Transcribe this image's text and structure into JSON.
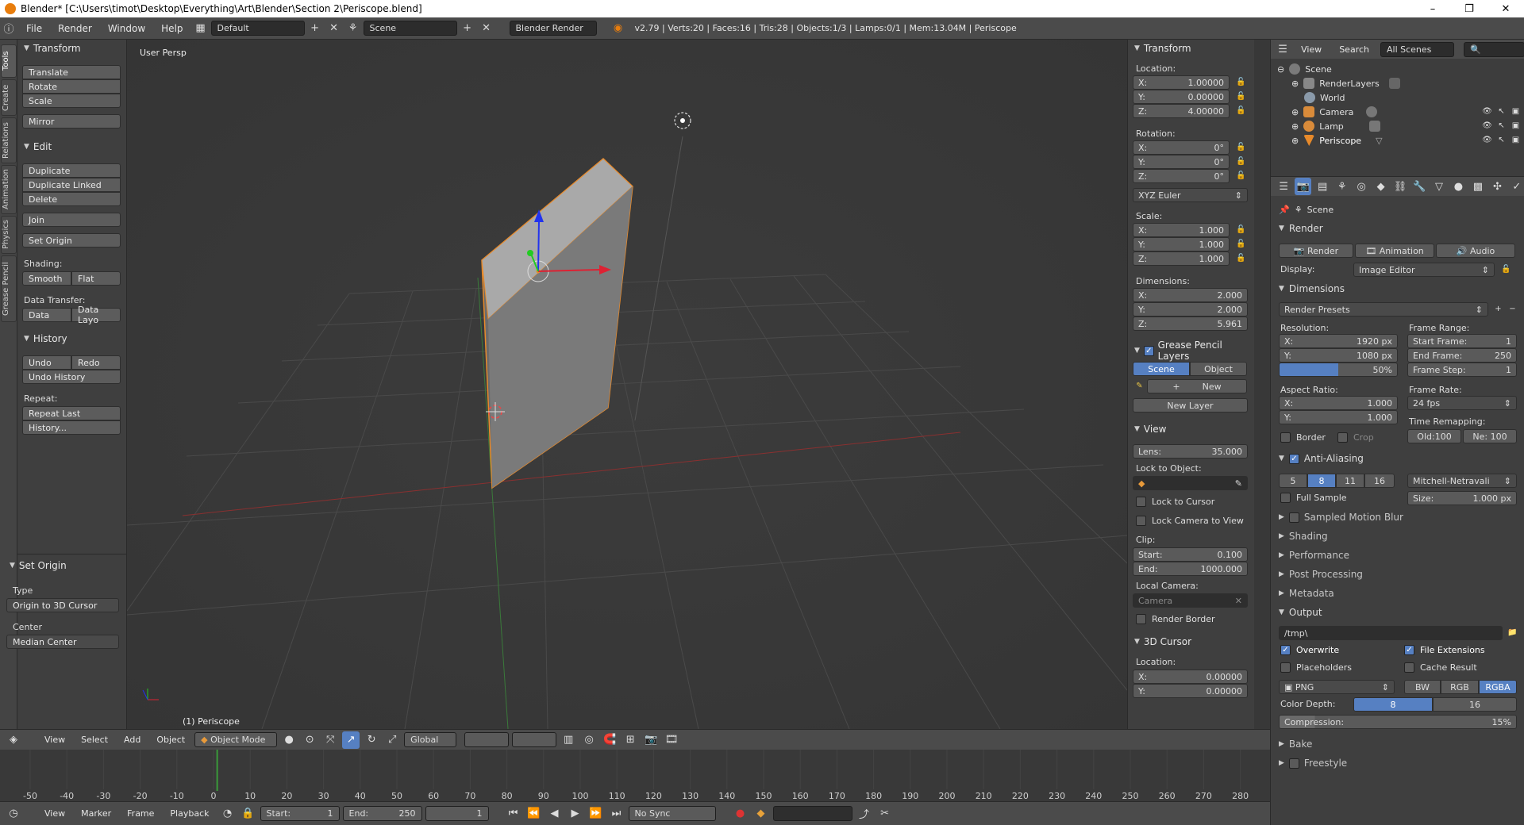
{
  "titlebar": {
    "title": "Blender* [C:\\Users\\timot\\Desktop\\Everything\\Art\\Blender\\Section 2\\Periscope.blend]",
    "minimize": "–",
    "maximize": "❐",
    "close": "✕"
  },
  "infobar": {
    "menus": [
      "File",
      "Render",
      "Window",
      "Help"
    ],
    "layout": "Default",
    "scene": "Scene",
    "engine": "Blender Render",
    "stats": "v2.79 | Verts:20 | Faces:16 | Tris:28 | Objects:1/3 | Lamps:0/1 | Mem:13.04M | Periscope"
  },
  "left_tabs": [
    "Tools",
    "Create",
    "Relations",
    "Animation",
    "Physics",
    "Grease Pencil"
  ],
  "toolshelf": {
    "transform_header": "Transform",
    "transform_buttons": [
      "Translate",
      "Rotate",
      "Scale",
      "Mirror"
    ],
    "edit_header": "Edit",
    "edit_buttons": [
      "Duplicate",
      "Duplicate Linked",
      "Delete",
      "Join",
      "Set Origin"
    ],
    "shading_label": "Shading:",
    "shading_smooth": "Smooth",
    "shading_flat": "Flat",
    "data_transfer_label": "Data Transfer:",
    "data": "Data",
    "data_layo": "Data Layo",
    "history_header": "History",
    "undo": "Undo",
    "redo": "Redo",
    "undo_history": "Undo History",
    "repeat_label": "Repeat:",
    "repeat_last": "Repeat Last",
    "history_dots": "History...",
    "setorigin_header": "Set Origin",
    "type_label": "Type",
    "type_value": "Origin to 3D Cursor",
    "center_label": "Center",
    "center_value": "Median Center"
  },
  "viewport": {
    "view_label": "User Persp",
    "object_label": "(1) Periscope"
  },
  "npanel": {
    "transform_header": "Transform",
    "location_label": "Location:",
    "loc_x": "1.00000",
    "loc_y": "0.00000",
    "loc_z": "4.00000",
    "rotation_label": "Rotation:",
    "rot_x": "0°",
    "rot_y": "0°",
    "rot_z": "0°",
    "rot_mode": "XYZ Euler",
    "scale_label": "Scale:",
    "scale_x": "1.000",
    "scale_y": "1.000",
    "scale_z": "1.000",
    "dims_label": "Dimensions:",
    "dim_x": "2.000",
    "dim_y": "2.000",
    "dim_z": "5.961",
    "gp_header": "Grease Pencil Layers",
    "gp_scene": "Scene",
    "gp_object": "Object",
    "gp_new": "New",
    "gp_new_layer": "New Layer",
    "view_header": "View",
    "lens_label": "Lens:",
    "lens": "35.000",
    "lock_obj_label": "Lock to Object:",
    "lock_cursor": "Lock to Cursor",
    "lock_camera": "Lock Camera to View",
    "clip_label": "Clip:",
    "clip_start_label": "Start:",
    "clip_start": "0.100",
    "clip_end_label": "End:",
    "clip_end": "1000.000",
    "local_cam_label": "Local Camera:",
    "local_cam": "Camera",
    "render_border": "Render Border",
    "cursor_header": "3D Cursor",
    "cursor_loc_label": "Location:",
    "cur_x": "0.00000",
    "cur_y": "0.00000",
    "x": "X:",
    "y": "Y:",
    "z": "Z:"
  },
  "outliner": {
    "view": "View",
    "search": "Search",
    "scenes": "All Scenes",
    "items": [
      "Scene",
      "RenderLayers",
      "World",
      "Camera",
      "Lamp",
      "Periscope"
    ]
  },
  "props": {
    "scene": "Scene",
    "render_header": "Render",
    "render_btn": "Render",
    "animation_btn": "Animation",
    "audio_btn": "Audio",
    "display_label": "Display:",
    "display": "Image Editor",
    "dims_header": "Dimensions",
    "presets": "Render Presets",
    "resolution_label": "Resolution:",
    "res_x": "1920 px",
    "res_y": "1080 px",
    "res_pct": "50%",
    "frame_range_label": "Frame Range:",
    "start_frame_label": "Start Frame:",
    "start_frame": "1",
    "end_frame_label": "End Frame:",
    "end_frame": "250",
    "frame_step_label": "Frame Step:",
    "frame_step": "1",
    "aspect_label": "Aspect Ratio:",
    "asp_x": "1.000",
    "asp_y": "1.000",
    "frame_rate_label": "Frame Rate:",
    "fps": "24 fps",
    "remap_label": "Time Remapping:",
    "old": "Old:100",
    "new": "Ne: 100",
    "border": "Border",
    "crop": "Crop",
    "aa_header": "Anti-Aliasing",
    "aa_samples": [
      "5",
      "8",
      "11",
      "16"
    ],
    "aa_filter": "Mitchell-Netravali",
    "full_sample": "Full Sample",
    "size_label": "Size:",
    "size": "1.000 px",
    "collapsed": [
      "Sampled Motion Blur",
      "Shading",
      "Performance",
      "Post Processing",
      "Metadata"
    ],
    "output_header": "Output",
    "path": "/tmp\\",
    "overwrite": "Overwrite",
    "file_ext": "File Extensions",
    "placeholders": "Placeholders",
    "cache_result": "Cache Result",
    "format": "PNG",
    "bw": "BW",
    "rgb": "RGB",
    "rgba": "RGBA",
    "color_depth_label": "Color Depth:",
    "depth8": "8",
    "depth16": "16",
    "compression_label": "Compression:",
    "compression": "15%",
    "bake": "Bake",
    "freestyle": "Freestyle"
  },
  "v3dheader": {
    "menus": [
      "View",
      "Select",
      "Add",
      "Object"
    ],
    "mode": "Object Mode",
    "orientation": "Global"
  },
  "timeline": {
    "ticks": [
      "-50",
      "-40",
      "-30",
      "-20",
      "-10",
      "0",
      "10",
      "20",
      "30",
      "40",
      "50",
      "60",
      "70",
      "80",
      "90",
      "100",
      "110",
      "120",
      "130",
      "140",
      "150",
      "160",
      "170",
      "180",
      "190",
      "200",
      "210",
      "220",
      "230",
      "240",
      "250",
      "260",
      "270",
      "280"
    ],
    "current_frame": 1
  },
  "tlheader": {
    "menus": [
      "View",
      "Marker",
      "Frame",
      "Playback"
    ],
    "start_label": "Start:",
    "start": "1",
    "end_label": "End:",
    "end": "250",
    "current": "1",
    "sync": "No Sync"
  },
  "colors": {
    "accent": "#5680c2",
    "selected_outline": "#e88a2a",
    "x_axis": "#b33",
    "y_axis": "#3a3",
    "z_axis": "#2244ee"
  }
}
